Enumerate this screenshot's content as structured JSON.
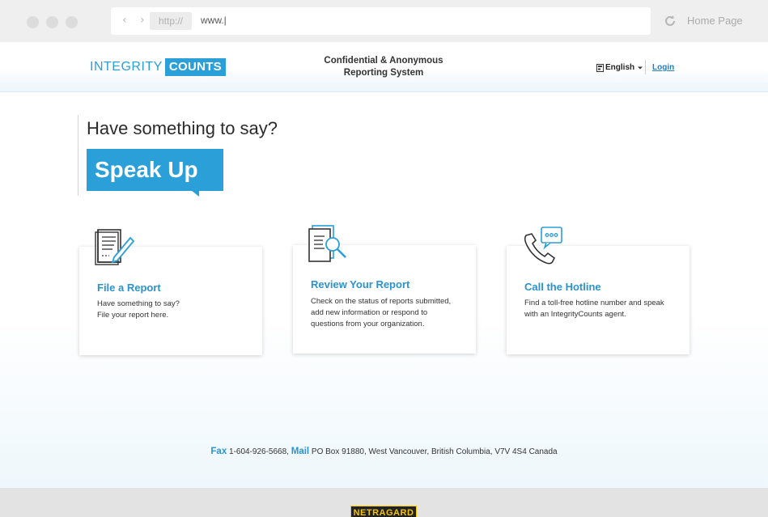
{
  "browser": {
    "url_protocol": "http://",
    "url_text": "www.|",
    "home_label": "Home Page"
  },
  "header": {
    "logo_part1": "INTEGRITY",
    "logo_part2": "COUNTS",
    "tagline_line1": "Confidential & Anonymous",
    "tagline_line2": "Reporting System",
    "language": "English",
    "login_label": "Login"
  },
  "hero": {
    "question": "Have something to say?",
    "callout": "Speak Up"
  },
  "cards": [
    {
      "title": "File a Report",
      "desc_line1": "Have something to say?",
      "desc_line2": "File your report here."
    },
    {
      "title": "Review Your Report",
      "desc": "Check on the status of reports submitted, add new information or respond to questions from your organization."
    },
    {
      "title": "Call the Hotline",
      "desc": "Find a toll-free hotline number and speak with an IntegrityCounts agent."
    }
  ],
  "contact": {
    "fax_label": "Fax",
    "fax_number": "1-604-926-5668,",
    "mail_label": "Mail",
    "mail_address": "PO Box 91880, West Vancouver, British Columbia, V7V 4S4 Canada"
  },
  "footer": {
    "brand": "NETRAGARD"
  },
  "colors": {
    "accent": "#2a9fd8",
    "link": "#1d7fbf"
  }
}
